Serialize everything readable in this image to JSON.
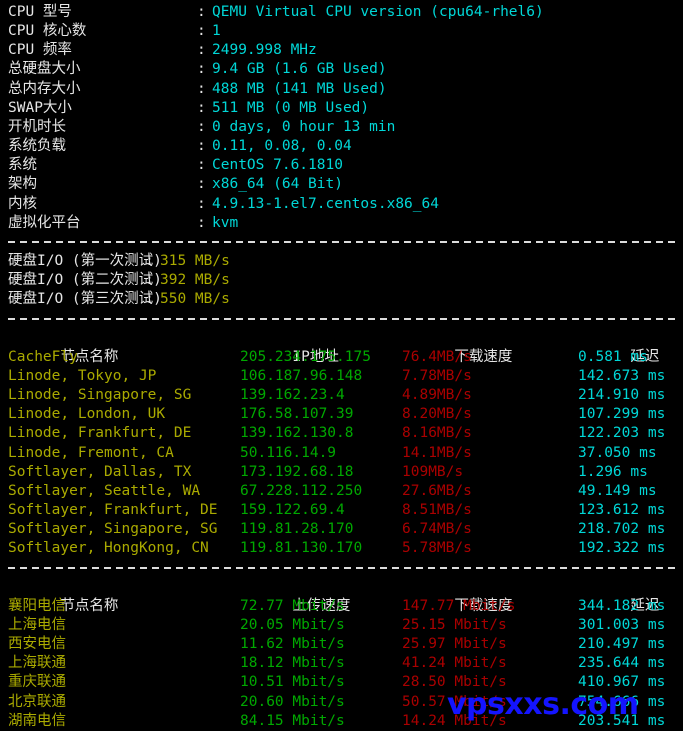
{
  "system_info": {
    "colon": ":",
    "rows": [
      {
        "label": "CPU 型号",
        "value": "QEMU Virtual CPU version (cpu64-rhel6)"
      },
      {
        "label": "CPU 核心数",
        "value": "1"
      },
      {
        "label": "CPU 频率",
        "value": "2499.998 MHz"
      },
      {
        "label": "总硬盘大小",
        "value": "9.4 GB (1.6 GB Used)"
      },
      {
        "label": "总内存大小",
        "value": "488 MB (141 MB Used)"
      },
      {
        "label": "SWAP大小",
        "value": "511 MB (0 MB Used)"
      },
      {
        "label": "开机时长",
        "value": "0 days, 0 hour 13 min"
      },
      {
        "label": "系统负载",
        "value": "0.11, 0.08, 0.04"
      },
      {
        "label": "系统",
        "value": "CentOS 7.6.1810"
      },
      {
        "label": "架构",
        "value": "x86_64 (64 Bit)"
      },
      {
        "label": "内核",
        "value": "4.9.13-1.el7.centos.x86_64"
      },
      {
        "label": "虚拟化平台",
        "value": "kvm"
      }
    ]
  },
  "disk_io": {
    "colon": ":",
    "rows": [
      {
        "label": "硬盘I/O (第一次测试)",
        "value": "315 MB/s"
      },
      {
        "label": "硬盘I/O (第二次测试)",
        "value": "392 MB/s"
      },
      {
        "label": "硬盘I/O (第三次测试)",
        "value": "550 MB/s"
      }
    ]
  },
  "intl_speedtest": {
    "headers": {
      "node": "节点名称",
      "ip": "IP地址",
      "download": "下载速度",
      "latency": "延迟"
    },
    "rows": [
      {
        "node": "CacheFly",
        "ip": "205.234.175.175",
        "download": "76.4MB/s",
        "latency": "0.581 ms"
      },
      {
        "node": "Linode, Tokyo, JP",
        "ip": "106.187.96.148",
        "download": "7.78MB/s",
        "latency": "142.673 ms"
      },
      {
        "node": "Linode, Singapore, SG",
        "ip": "139.162.23.4",
        "download": "4.89MB/s",
        "latency": "214.910 ms"
      },
      {
        "node": "Linode, London, UK",
        "ip": "176.58.107.39",
        "download": "8.20MB/s",
        "latency": "107.299 ms"
      },
      {
        "node": "Linode, Frankfurt, DE",
        "ip": "139.162.130.8",
        "download": "8.16MB/s",
        "latency": "122.203 ms"
      },
      {
        "node": "Linode, Fremont, CA",
        "ip": "50.116.14.9",
        "download": "14.1MB/s",
        "latency": "37.050 ms"
      },
      {
        "node": "Softlayer, Dallas, TX",
        "ip": "173.192.68.18",
        "download": "109MB/s",
        "latency": "1.296 ms"
      },
      {
        "node": "Softlayer, Seattle, WA",
        "ip": "67.228.112.250",
        "download": "27.6MB/s",
        "latency": "49.149 ms"
      },
      {
        "node": "Softlayer, Frankfurt, DE",
        "ip": "159.122.69.4",
        "download": "8.51MB/s",
        "latency": "123.612 ms"
      },
      {
        "node": "Softlayer, Singapore, SG",
        "ip": "119.81.28.170",
        "download": "6.74MB/s",
        "latency": "218.702 ms"
      },
      {
        "node": "Softlayer, HongKong, CN",
        "ip": "119.81.130.170",
        "download": "5.78MB/s",
        "latency": "192.322 ms"
      }
    ]
  },
  "cn_speedtest": {
    "headers": {
      "node": "节点名称",
      "upload": "上传速度",
      "download": "下载速度",
      "latency": "延迟"
    },
    "rows": [
      {
        "node": "襄阳电信",
        "upload": "72.77 Mbit/s",
        "download": "147.77 Mbit/s",
        "latency": "344.182 ms"
      },
      {
        "node": "上海电信",
        "upload": "20.05 Mbit/s",
        "download": "25.15 Mbit/s",
        "latency": "301.003 ms"
      },
      {
        "node": "西安电信",
        "upload": "11.62 Mbit/s",
        "download": "25.97 Mbit/s",
        "latency": "210.497 ms"
      },
      {
        "node": "上海联通",
        "upload": "18.12 Mbit/s",
        "download": "41.24 Mbit/s",
        "latency": "235.644 ms"
      },
      {
        "node": "重庆联通",
        "upload": "10.51 Mbit/s",
        "download": "28.50 Mbit/s",
        "latency": "410.967 ms"
      },
      {
        "node": "北京联通",
        "upload": "20.60 Mbit/s",
        "download": "50.57 Mbit/s",
        "latency": "754.666 ms"
      },
      {
        "node": "湖南电信",
        "upload": "84.15 Mbit/s",
        "download": "14.24 Mbit/s",
        "latency": "203.541 ms"
      }
    ]
  },
  "watermark": {
    "text": "vpsxxs.com",
    "color": "#1414ff"
  },
  "colors": {
    "background": "#000000",
    "default_text": "#e6e6e6",
    "value_cyan": "#00d7d7",
    "io_yellow": "#aaaa00",
    "node_yellow": "#aaaa00",
    "ip_green": "#00a800",
    "upload_green": "#00a800",
    "download_red": "#aa0000",
    "latency_cyan": "#00d7d7"
  }
}
